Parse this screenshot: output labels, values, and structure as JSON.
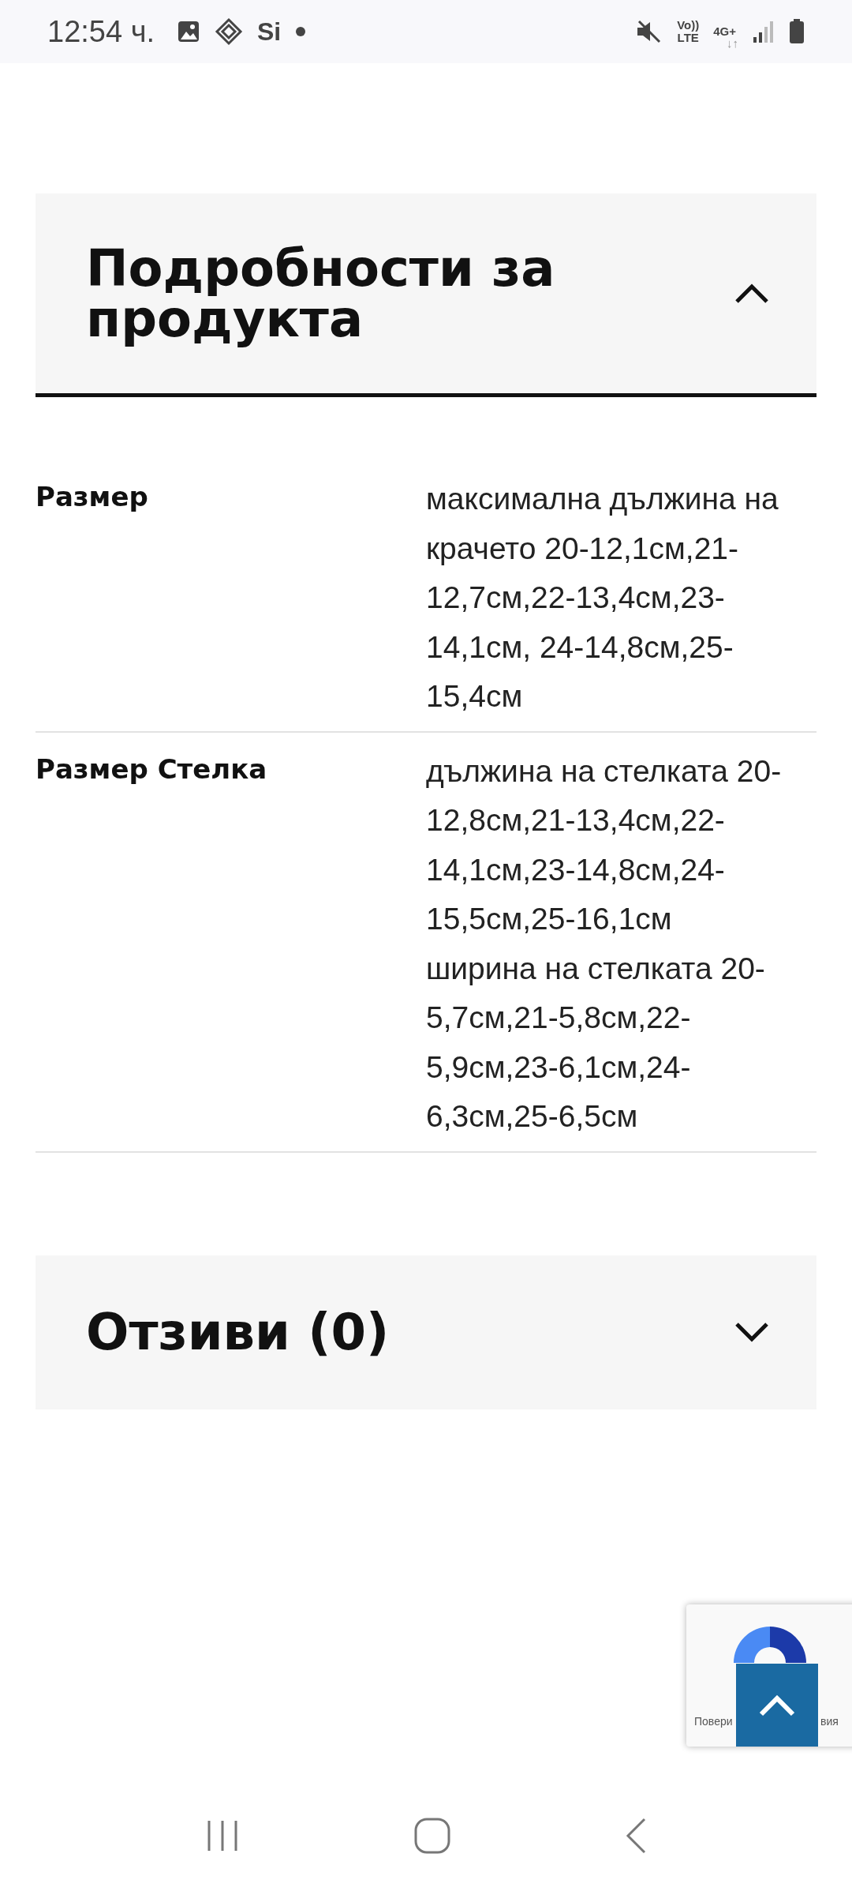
{
  "status_bar": {
    "time": "12:54 ч.",
    "app_glyph": "Si",
    "volte": [
      "Vo))",
      "LTE"
    ],
    "network": "4G+",
    "network_arrows": "↓↑"
  },
  "details": {
    "title": "Подробности за продукта",
    "expanded": true,
    "rows": [
      {
        "label": "Размер",
        "paragraphs": [
          "максимална дължина на крачето 20-12,1см,21-12,7см,22-13,4см,23-14,1см, 24-14,8см,25-15,4см"
        ]
      },
      {
        "label": "Размер Стелка",
        "paragraphs": [
          "дължина на стелката 20-12,8см,21-13,4см,22-14,1см,23-14,8см,24-15,5см,25-16,1см",
          "ширина на стелката 20-5,7см,21-5,8см,22-5,9см,23-6,1см,24-6,3см,25-6,5см"
        ]
      }
    ]
  },
  "reviews": {
    "title": "Отзиви (0)",
    "expanded": false
  },
  "recaptcha": {
    "text_left": "Повери",
    "text_right": "вия"
  }
}
